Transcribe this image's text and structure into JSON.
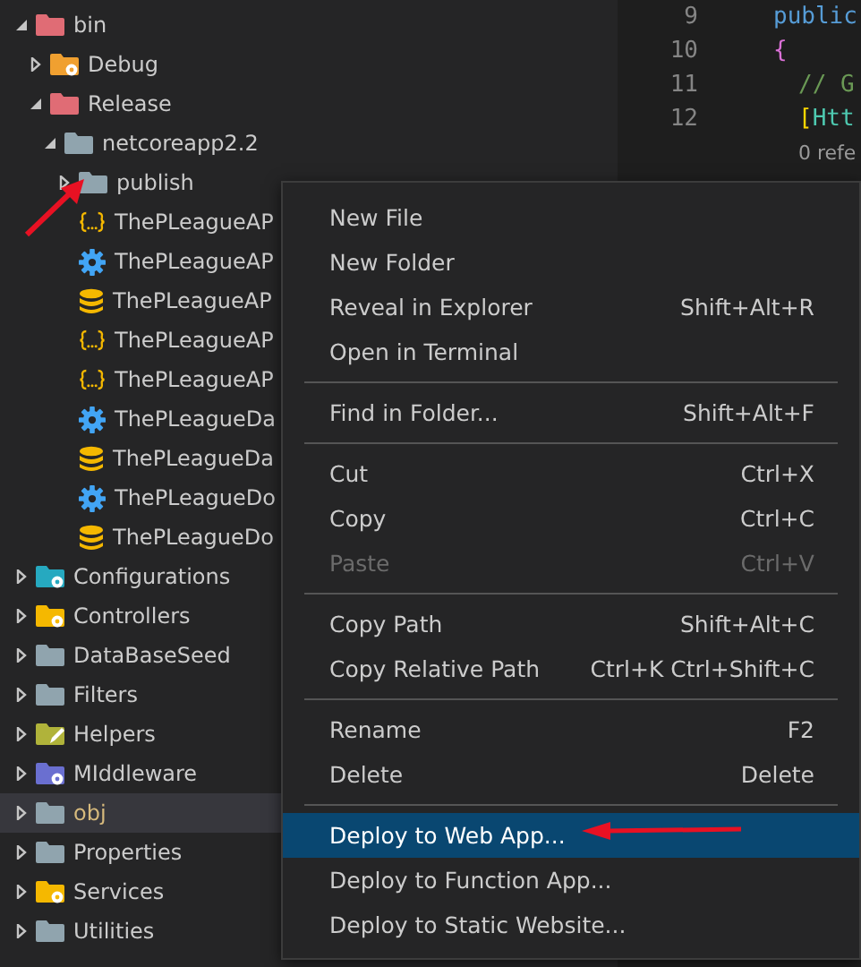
{
  "explorer": {
    "items": [
      {
        "label": "bin",
        "kind": "folder",
        "color": "#e06c75",
        "expanded": true,
        "gear": false,
        "pencil": false,
        "children": [
          {
            "label": "Debug",
            "kind": "folder",
            "color": "#f0a030",
            "expanded": false,
            "gear": true,
            "pencil": false
          },
          {
            "label": "Release",
            "kind": "folder",
            "color": "#e06c75",
            "expanded": true,
            "gear": false,
            "pencil": false,
            "children": [
              {
                "label": "netcoreapp2.2",
                "kind": "folder",
                "color": "#90a4ae",
                "expanded": true,
                "gear": false,
                "pencil": false,
                "children": [
                  {
                    "label": "publish",
                    "kind": "folder",
                    "color": "#90a4ae",
                    "expanded": false,
                    "gear": false,
                    "pencil": false
                  },
                  {
                    "label": "ThePLeagueAP",
                    "kind": "json"
                  },
                  {
                    "label": "ThePLeagueAP",
                    "kind": "settings"
                  },
                  {
                    "label": "ThePLeagueAP",
                    "kind": "database"
                  },
                  {
                    "label": "ThePLeagueAP",
                    "kind": "json"
                  },
                  {
                    "label": "ThePLeagueAP",
                    "kind": "json"
                  },
                  {
                    "label": "ThePLeagueDa",
                    "kind": "settings"
                  },
                  {
                    "label": "ThePLeagueDa",
                    "kind": "database"
                  },
                  {
                    "label": "ThePLeagueDo",
                    "kind": "settings"
                  },
                  {
                    "label": "ThePLeagueDo",
                    "kind": "database"
                  }
                ]
              }
            ]
          }
        ]
      },
      {
        "label": "Configurations",
        "kind": "folder",
        "color": "#26a9c0",
        "expanded": false,
        "gear": true,
        "pencil": false
      },
      {
        "label": "Controllers",
        "kind": "folder",
        "color": "#f5b800",
        "expanded": false,
        "gear": true,
        "pencil": false
      },
      {
        "label": "DataBaseSeed",
        "kind": "folder",
        "color": "#90a4ae",
        "expanded": false,
        "gear": false,
        "pencil": false
      },
      {
        "label": "Filters",
        "kind": "folder",
        "color": "#90a4ae",
        "expanded": false,
        "gear": false,
        "pencil": false
      },
      {
        "label": "Helpers",
        "kind": "folder",
        "color": "#b0b33a",
        "expanded": false,
        "gear": false,
        "pencil": true
      },
      {
        "label": "MIddleware",
        "kind": "folder",
        "color": "#6a6fd0",
        "expanded": false,
        "gear": true,
        "pencil": false
      },
      {
        "label": "obj",
        "kind": "folder",
        "color": "#90a4ae",
        "expanded": false,
        "gear": false,
        "pencil": false,
        "selected": true
      },
      {
        "label": "Properties",
        "kind": "folder",
        "color": "#90a4ae",
        "expanded": false,
        "gear": false,
        "pencil": false
      },
      {
        "label": "Services",
        "kind": "folder",
        "color": "#f5b800",
        "expanded": false,
        "gear": true,
        "pencil": false
      },
      {
        "label": "Utilities",
        "kind": "folder",
        "color": "#90a4ae",
        "expanded": false,
        "gear": false,
        "pencil": false
      }
    ]
  },
  "editor": {
    "lines": [
      {
        "number": "9",
        "tokens": [
          {
            "text": "public",
            "kind": "keyword"
          }
        ]
      },
      {
        "number": "10",
        "tokens": [
          {
            "text": "{",
            "kind": "brace"
          }
        ]
      },
      {
        "number": "11",
        "tokens": [
          {
            "text": "// G",
            "kind": "comment"
          }
        ]
      },
      {
        "number": "12",
        "tokens": [
          {
            "text": "[",
            "kind": "bracket"
          },
          {
            "text": "Htt",
            "kind": "type"
          }
        ]
      },
      {
        "kind": "codelens",
        "tokens": [
          {
            "text": "0 refe",
            "kind": "lens"
          }
        ]
      }
    ]
  },
  "context_menu": {
    "groups": [
      [
        {
          "label": "New File",
          "disabled": false,
          "selected": false
        },
        {
          "label": "New Folder",
          "disabled": false,
          "selected": false
        },
        {
          "label": "Reveal in Explorer",
          "shortcut": "Shift+Alt+R",
          "disabled": false,
          "selected": false
        },
        {
          "label": "Open in Terminal",
          "disabled": false,
          "selected": false
        }
      ],
      [
        {
          "label": "Find in Folder...",
          "shortcut": "Shift+Alt+F",
          "disabled": false,
          "selected": false
        }
      ],
      [
        {
          "label": "Cut",
          "shortcut": "Ctrl+X",
          "disabled": false,
          "selected": false
        },
        {
          "label": "Copy",
          "shortcut": "Ctrl+C",
          "disabled": false,
          "selected": false
        },
        {
          "label": "Paste",
          "shortcut": "Ctrl+V",
          "disabled": true,
          "selected": false
        }
      ],
      [
        {
          "label": "Copy Path",
          "shortcut": "Shift+Alt+C",
          "disabled": false,
          "selected": false
        },
        {
          "label": "Copy Relative Path",
          "shortcut": "Ctrl+K Ctrl+Shift+C",
          "disabled": false,
          "selected": false
        }
      ],
      [
        {
          "label": "Rename",
          "shortcut": "F2",
          "disabled": false,
          "selected": false
        },
        {
          "label": "Delete",
          "shortcut": "Delete",
          "disabled": false,
          "selected": false
        }
      ],
      [
        {
          "label": "Deploy to Web App...",
          "disabled": false,
          "selected": true
        },
        {
          "label": "Deploy to Function App...",
          "disabled": false,
          "selected": false
        },
        {
          "label": "Deploy to Static Website...",
          "disabled": false,
          "selected": false
        }
      ]
    ]
  }
}
